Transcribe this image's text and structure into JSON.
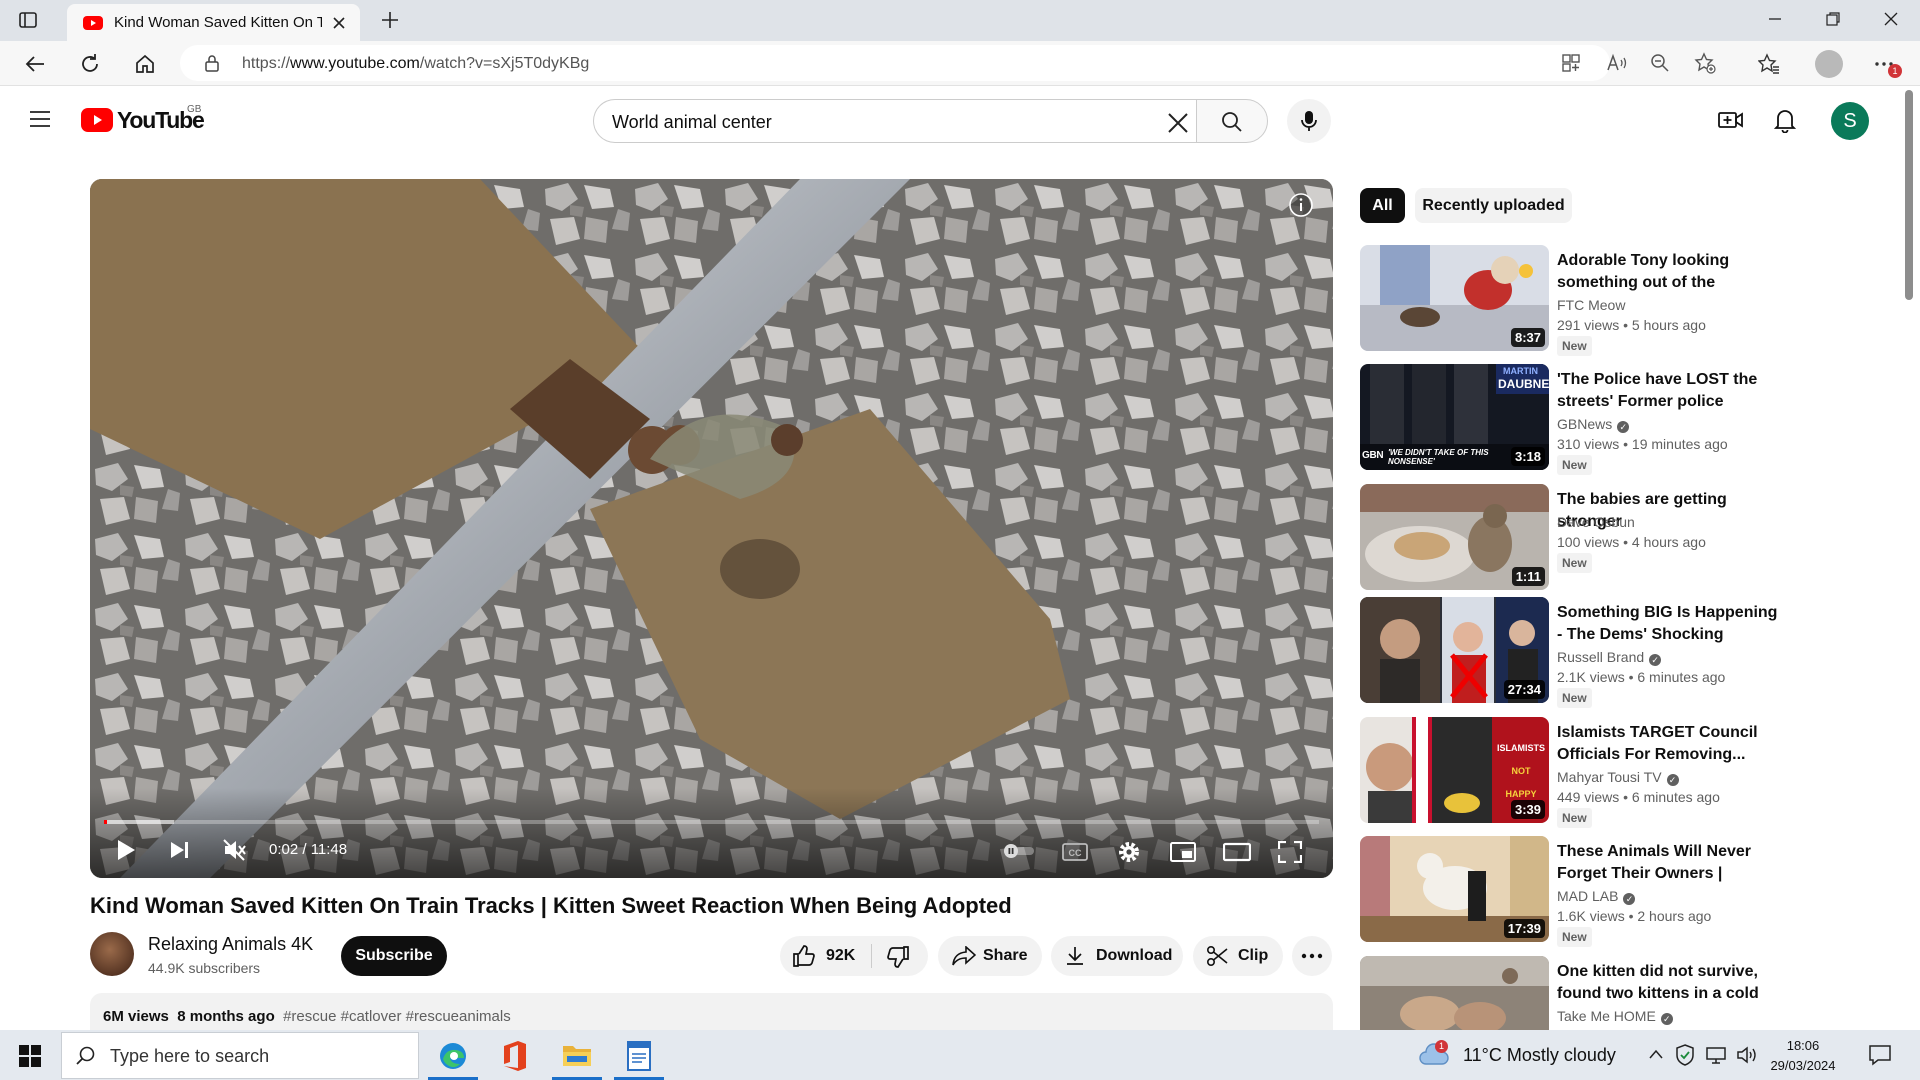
{
  "browser": {
    "tab_title": "Kind Woman Saved Kitten On T",
    "url_prefix": "https://",
    "url_host": "www.youtube.com",
    "url_path": "/watch?v=sXj5T0dyKBg",
    "notification_count": "1"
  },
  "youtube": {
    "logo_text": "YouTube",
    "region": "GB",
    "search_value": "World animal center",
    "avatar_letter": "S"
  },
  "player": {
    "time": "0:02 / 11:48",
    "progress_fraction": 0.0028
  },
  "video": {
    "title": "Kind Woman Saved Kitten On Train Tracks | Kitten Sweet Reaction When Being Adopted",
    "channel": "Relaxing Animals 4K",
    "subscribers": "44.9K subscribers",
    "subscribe_label": "Subscribe",
    "likes": "92K",
    "share_label": "Share",
    "download_label": "Download",
    "clip_label": "Clip",
    "views": "6M views",
    "age": "8 months ago",
    "tags": "#rescue #catlover #rescueanimals"
  },
  "sidebar": {
    "chips": [
      "All",
      "Recently uploaded"
    ],
    "items": [
      {
        "title": "Adorable Tony looking something out of the house?...",
        "channel": "FTC Meow",
        "meta": "291 views  • 5 hours ago",
        "new": "New",
        "duration": "8:37",
        "verified": false
      },
      {
        "title": "'The Police have LOST the streets' Former police officer...",
        "channel": "GBNews",
        "meta": "310 views  • 19 minutes ago",
        "new": "New",
        "duration": "3:18",
        "verified": true,
        "overlay_top": "DAUBNEY",
        "overlay_top_small": "MARTIN",
        "overlay_bottom": "'WE DIDN'T TAKE OF THIS NONSENSE'"
      },
      {
        "title": "The babies are getting stronger",
        "channel": "Dave Osbun",
        "meta": "100 views  • 4 hours ago",
        "new": "New",
        "duration": "1:11",
        "verified": false
      },
      {
        "title": "Something BIG Is Happening - The Dems' Shocking Agenda...",
        "channel": "Russell Brand",
        "meta": "2.1K views  • 6 minutes ago",
        "new": "New",
        "duration": "27:34",
        "verified": true
      },
      {
        "title": "Islamists TARGET Council Officials For Removing...",
        "channel": "Mahyar Tousi TV",
        "meta": "449 views  • 6 minutes ago",
        "new": "New",
        "duration": "3:39",
        "verified": true,
        "overlay_lines": [
          "ISLAMISTS",
          "NOT",
          "HAPPY"
        ]
      },
      {
        "title": "These Animals Will Never Forget Their Owners | Animal...",
        "channel": "MAD LAB",
        "meta": "1.6K views  • 2 hours ago",
        "new": "New",
        "duration": "17:39",
        "verified": true
      },
      {
        "title": "One kitten did not survive, we found two kittens in a cold and...",
        "channel": "Take Me HOME",
        "meta": "",
        "new": "",
        "duration": "",
        "verified": true
      }
    ]
  },
  "taskbar": {
    "search_placeholder": "Type here to search",
    "weather": "11°C  Mostly cloudy",
    "weather_badge": "1",
    "time": "18:06",
    "date": "29/03/2024"
  }
}
